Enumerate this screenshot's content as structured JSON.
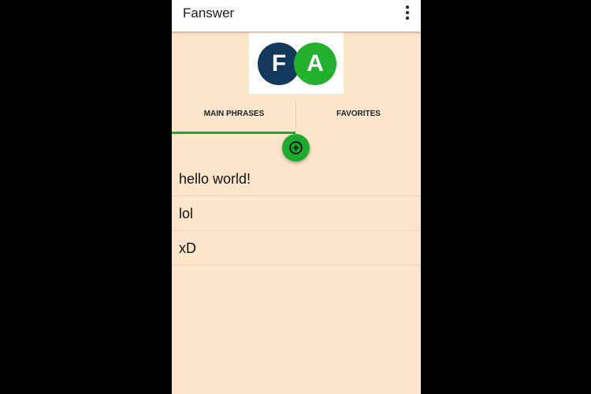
{
  "app": {
    "title": "Fanswer"
  },
  "logo": {
    "letter_f": "F",
    "letter_a": "A"
  },
  "tabs": [
    {
      "label": "MAIN PHRASES",
      "active": true
    },
    {
      "label": "FAVORITES",
      "active": false
    }
  ],
  "phrases": [
    "hello world!",
    "lol",
    "xD"
  ],
  "icons": {
    "overflow": "more-vert-icon",
    "add": "add-circle-icon"
  },
  "colors": {
    "background": "#fde5cb",
    "appbar": "#ffffff",
    "accent_green": "#1faa2f",
    "logo_navy": "#12395c",
    "logo_green": "#22b02e"
  }
}
